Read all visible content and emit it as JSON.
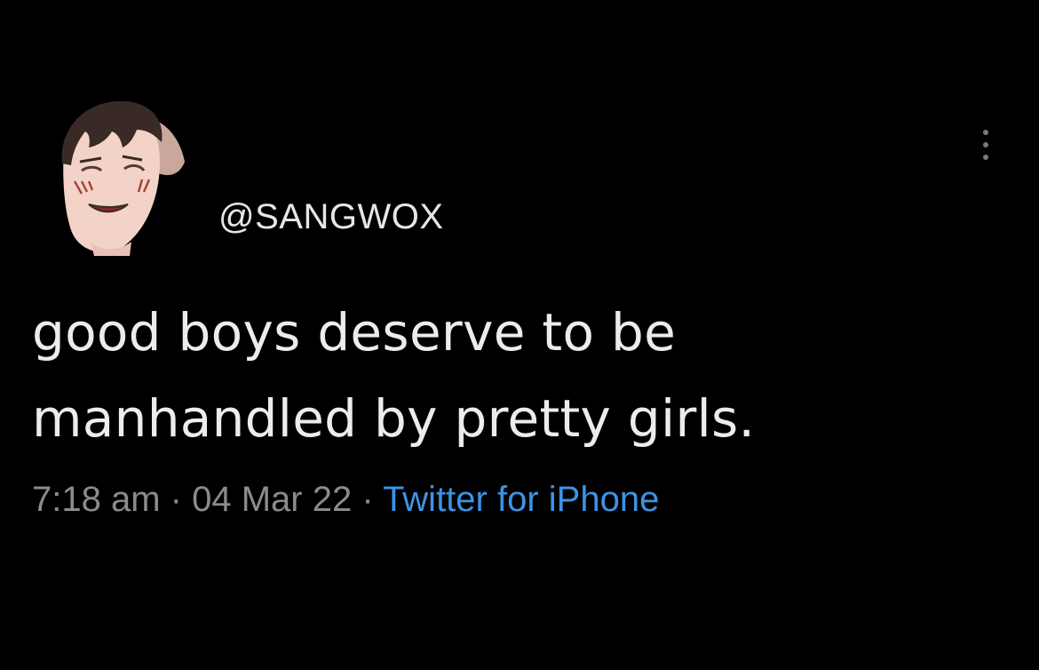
{
  "tweet": {
    "handle": "@SANGWOX",
    "text_lines": [
      "good boys deserve to be",
      "manhandled by pretty girls."
    ],
    "time": "7:18 am",
    "separator": "·",
    "date": "04 Mar 22",
    "source": "Twitter for iPhone"
  },
  "icons": {
    "more": "more-vertical-icon",
    "avatar": "avatar"
  },
  "colors": {
    "background": "#000000",
    "text": "#ececec",
    "meta": "#8b8b8b",
    "link": "#3d93e5"
  }
}
